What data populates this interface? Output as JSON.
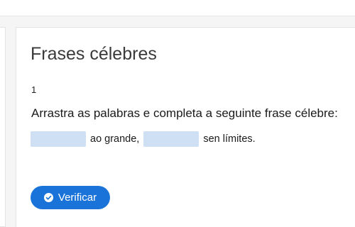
{
  "card": {
    "title": "Frases célebres",
    "question_number": "1",
    "instruction": "Arrastra as palabras e completa a seguinte frase célebre:",
    "sentence": {
      "segment_1": "ao grande,",
      "segment_2": "sen límites."
    },
    "verify_button": {
      "label": "Verificar",
      "icon": "check-circle-icon"
    }
  },
  "colors": {
    "accent": "#1a73d9",
    "dropzone": "#cfe0f5"
  }
}
